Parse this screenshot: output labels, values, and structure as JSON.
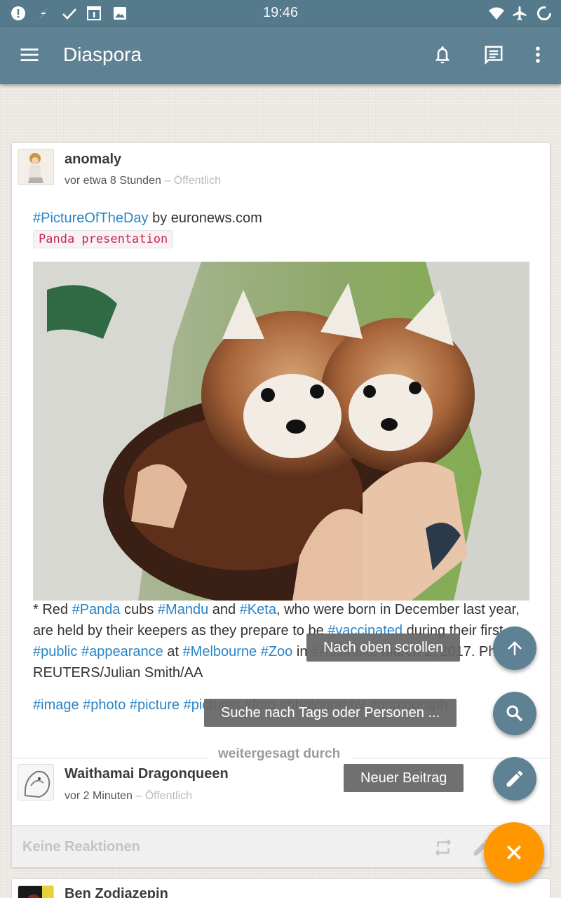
{
  "status_bar": {
    "time": "19:46",
    "left_icons": [
      "alert-icon",
      "flash-icon",
      "check-icon",
      "calendar-icon",
      "image-icon"
    ],
    "right_icons": [
      "wifi-icon",
      "airplane-icon",
      "sync-icon"
    ]
  },
  "app_bar": {
    "title": "Diaspora",
    "icons": [
      "menu-icon",
      "bell-icon",
      "message-icon",
      "more-vert-icon"
    ]
  },
  "post": {
    "author": "anomaly",
    "time_ago": "vor etwa 8 Stunden",
    "separator": " – ",
    "visibility": "Öffentlich",
    "headline_tag": "#PictureOfTheDay",
    "headline_rest": " by euronews.com",
    "code_chip": "Panda presentation",
    "caption_segments": [
      {
        "t": "* Red ",
        "tag": false
      },
      {
        "t": "#Panda",
        "tag": true
      },
      {
        "t": " cubs ",
        "tag": false
      },
      {
        "t": "#Mandu",
        "tag": true
      },
      {
        "t": " and ",
        "tag": false
      },
      {
        "t": "#Keta",
        "tag": true
      },
      {
        "t": ", who were born in December last year, are held by their keepers as they prepare to be ",
        "tag": false
      },
      {
        "t": "#vaccinated",
        "tag": true
      },
      {
        "t": " during their first ",
        "tag": false
      },
      {
        "t": "#public",
        "tag": true
      },
      {
        "t": " ",
        "tag": false
      },
      {
        "t": "#appearance",
        "tag": true
      },
      {
        "t": " at ",
        "tag": false
      },
      {
        "t": "#Melbourne",
        "tag": true
      },
      {
        "t": " ",
        "tag": false
      },
      {
        "t": "#Zoo",
        "tag": true
      },
      {
        "t": " in ",
        "tag": false
      },
      {
        "t": "#Australia",
        "tag": true
      },
      {
        "t": ", March 2, 2017. Photo: REUTERS/Julian Smith/AA",
        "tag": false
      }
    ],
    "tags_line": "#image #photo #picture #pictures #foto #photography #photograph",
    "reshared_label": "weitergesagt durch",
    "resharer": {
      "name": "Waithamai Dragonqueen",
      "time_ago": "vor 2 Minuten",
      "separator": " – ",
      "visibility": "Öffentlich"
    },
    "reactions_label": "Keine Reaktionen"
  },
  "next_post": {
    "author": "Ben Zodiazepin"
  },
  "fab_menu": {
    "scroll_top_label": "Nach oben scrollen",
    "search_label": "Suche nach Tags oder Personen ...",
    "new_post_label": "Neuer Beitrag"
  },
  "colors": {
    "primary": "#5e8293",
    "status_bar": "#557a8b",
    "accent": "#ff9800",
    "tag": "#2a84c6"
  }
}
